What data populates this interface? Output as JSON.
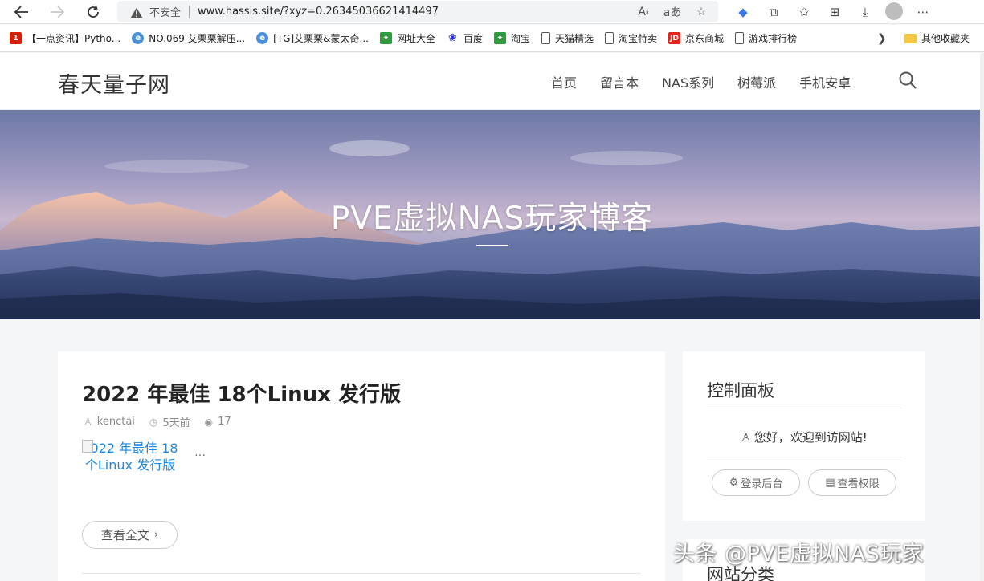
{
  "browser": {
    "insecure_label": "不安全",
    "url": "www.hassis.site/?xyz=0.26345036621414497",
    "bookmarks": [
      {
        "label": "【一点资讯】Pytho...",
        "icon": "yidian-icon",
        "color": "#d81e06"
      },
      {
        "label": "NO.069 艾栗栗解压...",
        "icon": "globe-icon",
        "color": "#4a90d9"
      },
      {
        "label": "[TG]艾栗栗&蒙太奇...",
        "icon": "globe-icon",
        "color": "#4a90d9"
      },
      {
        "label": "网址大全",
        "icon": "green-square-icon",
        "color": "#2e9b3e"
      },
      {
        "label": "百度",
        "icon": "baidu-paw-icon",
        "color": "#2932e1"
      },
      {
        "label": "淘宝",
        "icon": "green-square-icon",
        "color": "#2e9b3e"
      },
      {
        "label": "天猫精选",
        "icon": "page-icon",
        "color": "#ffffff"
      },
      {
        "label": "淘宝特卖",
        "icon": "page-icon",
        "color": "#ffffff"
      },
      {
        "label": "京东商城",
        "icon": "jd-icon",
        "color": "#e1251b"
      },
      {
        "label": "游戏排行榜",
        "icon": "page-icon",
        "color": "#ffffff"
      }
    ],
    "other_bookmarks": "其他收藏夹"
  },
  "site": {
    "logo": "春天量子网",
    "menu": [
      "首页",
      "留言本",
      "NAS系列",
      "树莓派",
      "手机安卓"
    ]
  },
  "hero": {
    "title": "PVE虚拟NAS玩家博客"
  },
  "post": {
    "title": "2022 年最佳 18个Linux 发行版",
    "author": "kenctai",
    "time": "5天前",
    "views": "17",
    "thumb_alt": "2022 年最佳 18个Linux 发行版",
    "excerpt": "…",
    "read_more": "查看全文"
  },
  "sidebar": {
    "panel_title": "控制面板",
    "welcome": "您好，欢迎到访网站!",
    "login_btn": "登录后台",
    "perm_btn": "查看权限",
    "category_title": "网站分类"
  },
  "watermark": "头条 @PVE虚拟NAS玩家"
}
